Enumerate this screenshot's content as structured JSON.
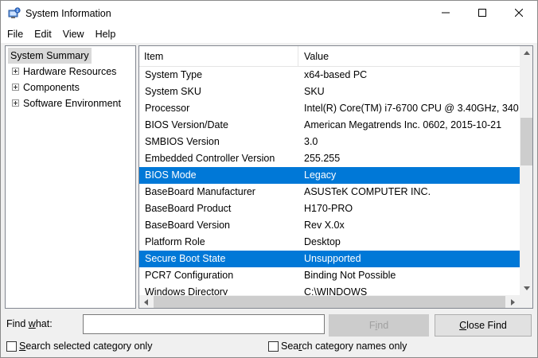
{
  "window": {
    "title": "System Information"
  },
  "menu": {
    "items": [
      "File",
      "Edit",
      "View",
      "Help"
    ]
  },
  "tree": {
    "root": "System Summary",
    "children": [
      "Hardware Resources",
      "Components",
      "Software Environment"
    ]
  },
  "list": {
    "columns": [
      "Item",
      "Value"
    ],
    "rows": [
      {
        "item": "System Type",
        "value": "x64-based PC",
        "selected": false
      },
      {
        "item": "System SKU",
        "value": "SKU",
        "selected": false
      },
      {
        "item": "Processor",
        "value": "Intel(R) Core(TM) i7-6700 CPU @ 3.40GHz, 340",
        "selected": false
      },
      {
        "item": "BIOS Version/Date",
        "value": "American Megatrends Inc. 0602, 2015-10-21",
        "selected": false
      },
      {
        "item": "SMBIOS Version",
        "value": "3.0",
        "selected": false
      },
      {
        "item": "Embedded Controller Version",
        "value": "255.255",
        "selected": false
      },
      {
        "item": "BIOS Mode",
        "value": "Legacy",
        "selected": true
      },
      {
        "item": "BaseBoard Manufacturer",
        "value": "ASUSTeK COMPUTER INC.",
        "selected": false
      },
      {
        "item": "BaseBoard Product",
        "value": "H170-PRO",
        "selected": false
      },
      {
        "item": "BaseBoard Version",
        "value": "Rev X.0x",
        "selected": false
      },
      {
        "item": "Platform Role",
        "value": "Desktop",
        "selected": false
      },
      {
        "item": "Secure Boot State",
        "value": "Unsupported",
        "selected": true
      },
      {
        "item": "PCR7 Configuration",
        "value": "Binding Not Possible",
        "selected": false
      },
      {
        "item": "Windows Directory",
        "value": "C:\\WINDOWS",
        "selected": false
      }
    ]
  },
  "find": {
    "label_pre": "Find ",
    "label_u": "w",
    "label_post": "hat:",
    "value": "",
    "find_pre": "F",
    "find_u": "i",
    "find_post": "nd",
    "close_pre": "",
    "close_u": "C",
    "close_post": "lose Find",
    "check1_pre": "",
    "check1_u": "S",
    "check1_post": "earch selected category only",
    "check2_pre": "Sea",
    "check2_u": "r",
    "check2_post": "ch category names only"
  },
  "colors": {
    "selection": "#0078d7",
    "disabled_text": "#a0a0a0"
  },
  "icons": {
    "app": "system-information-icon",
    "minimize": "minimize-icon",
    "maximize": "maximize-icon",
    "close": "close-icon"
  }
}
